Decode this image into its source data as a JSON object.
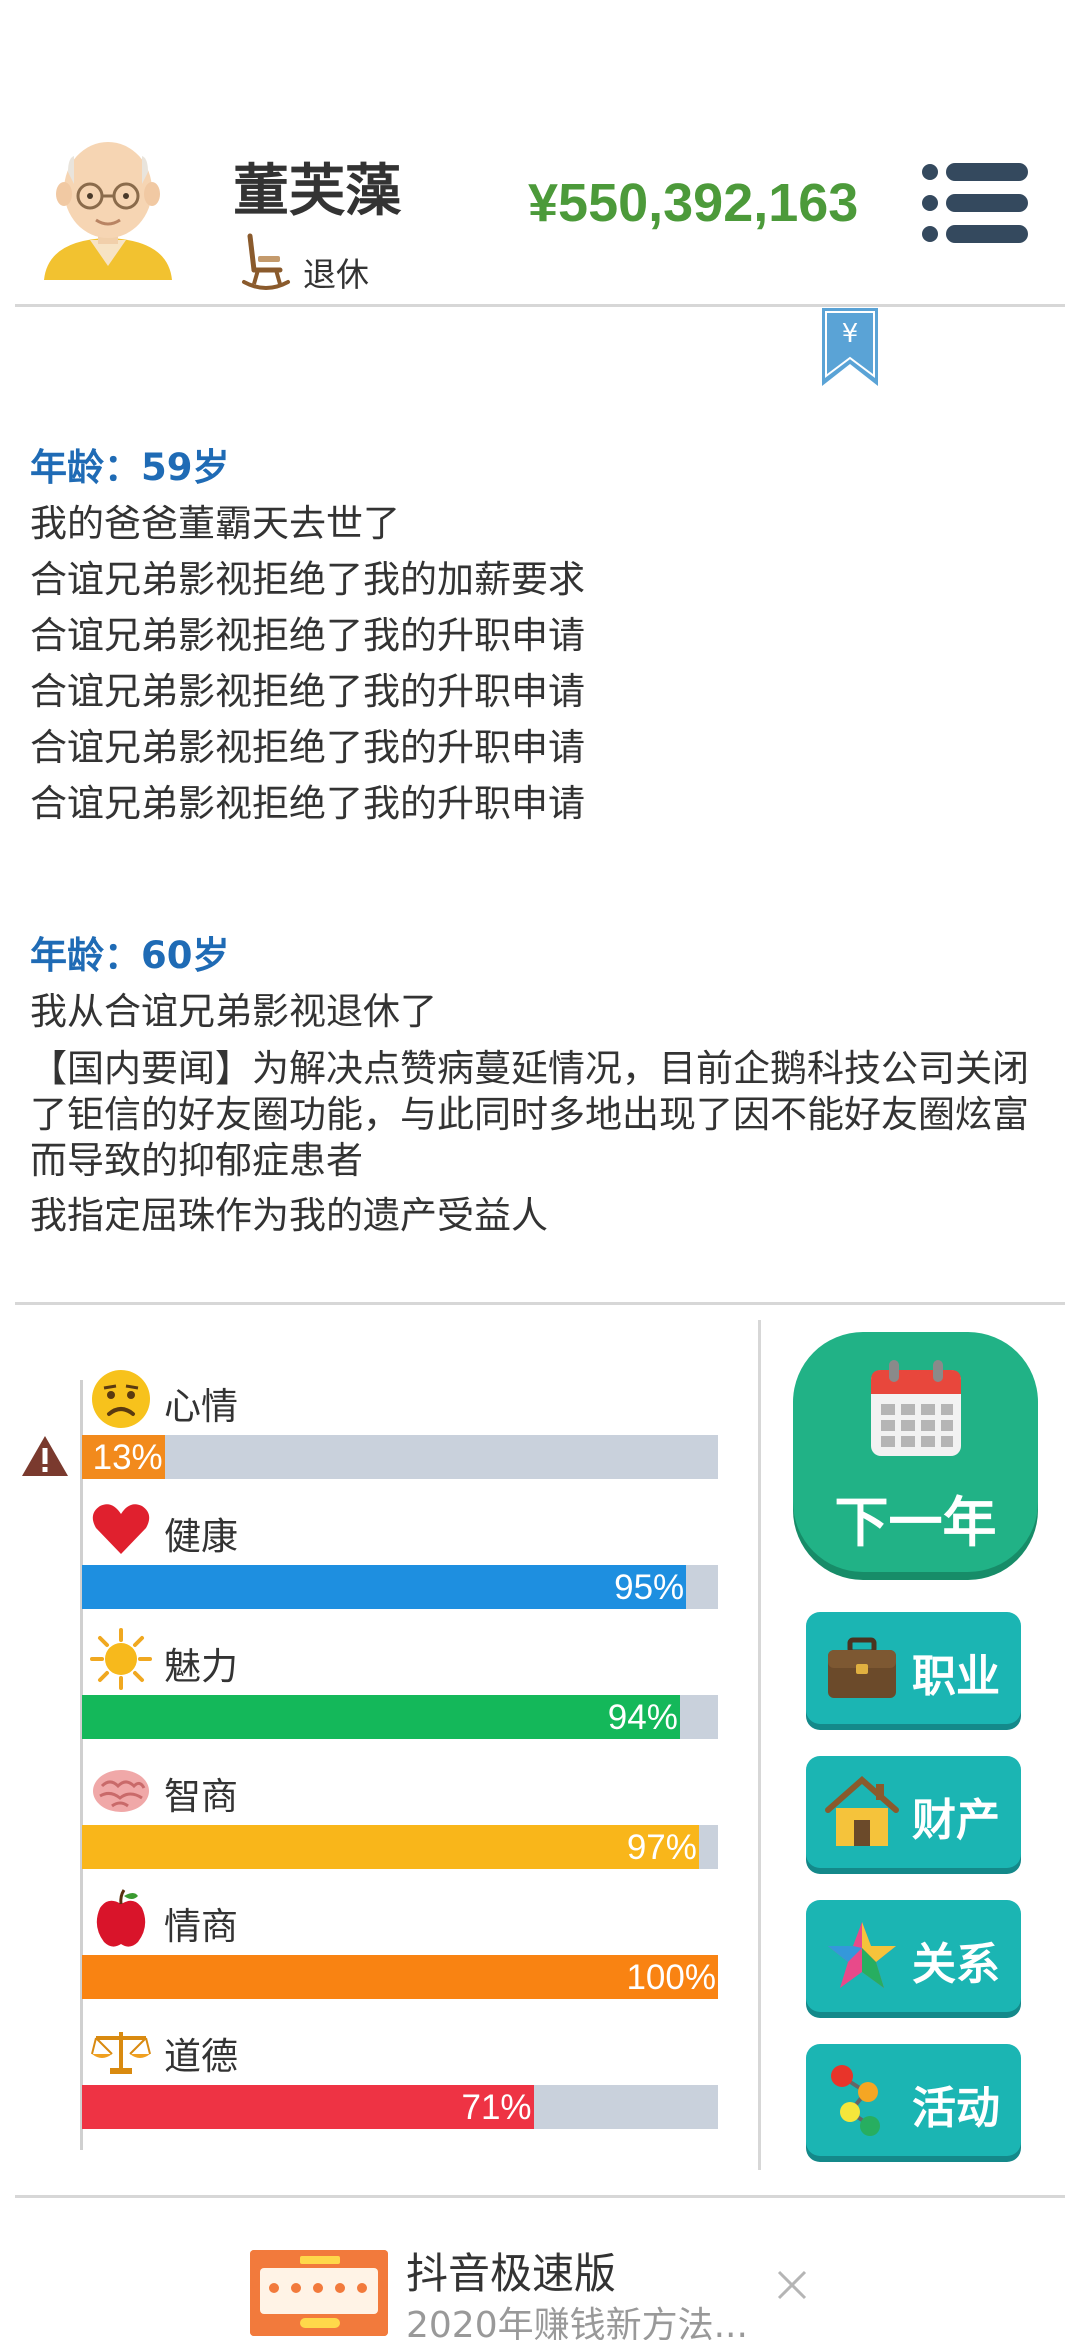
{
  "profile": {
    "name": "董芙藻",
    "status": "退休",
    "money": "¥550,392,163"
  },
  "log": [
    {
      "age": "年龄：59岁",
      "events": [
        "我的爸爸董霸天去世了",
        "合谊兄弟影视拒绝了我的加薪要求",
        "合谊兄弟影视拒绝了我的升职申请",
        "合谊兄弟影视拒绝了我的升职申请",
        "合谊兄弟影视拒绝了我的升职申请",
        "合谊兄弟影视拒绝了我的升职申请"
      ]
    },
    {
      "age": "年龄：60岁",
      "events": [
        "我从合谊兄弟影视退休了",
        "【国内要闻】为解决点赞病蔓延情况，目前企鹅科技公司关闭了钜信的好友圈功能，与此同时多地出现了因不能好友圈炫富而导致的抑郁症患者",
        "我指定屈珠作为我的遗产受益人"
      ]
    }
  ],
  "stats": [
    {
      "label": "心情",
      "value_text": "13%",
      "percent": 13,
      "color": "#f28a1c",
      "icon": "sad-face-icon",
      "warning": true
    },
    {
      "label": "健康",
      "value_text": "95%",
      "percent": 95,
      "color": "#1e8fe0",
      "icon": "heart-icon",
      "warning": false
    },
    {
      "label": "魅力",
      "value_text": "94%",
      "percent": 94,
      "color": "#14b85a",
      "icon": "sun-icon",
      "warning": false
    },
    {
      "label": "智商",
      "value_text": "97%",
      "percent": 97,
      "color": "#f9b61a",
      "icon": "brain-icon",
      "warning": false
    },
    {
      "label": "情商",
      "value_text": "100%",
      "percent": 100,
      "color": "#f98312",
      "icon": "apple-icon",
      "warning": false
    },
    {
      "label": "道德",
      "value_text": "71%",
      "percent": 71,
      "color": "#ee3344",
      "icon": "scales-icon",
      "warning": false
    }
  ],
  "actions": {
    "next_year": "下一年",
    "career": "职业",
    "assets": "财产",
    "relations": "关系",
    "activities": "活动"
  },
  "ad": {
    "title": "抖音极速版",
    "subtitle": "2020年赚钱新方法..."
  }
}
